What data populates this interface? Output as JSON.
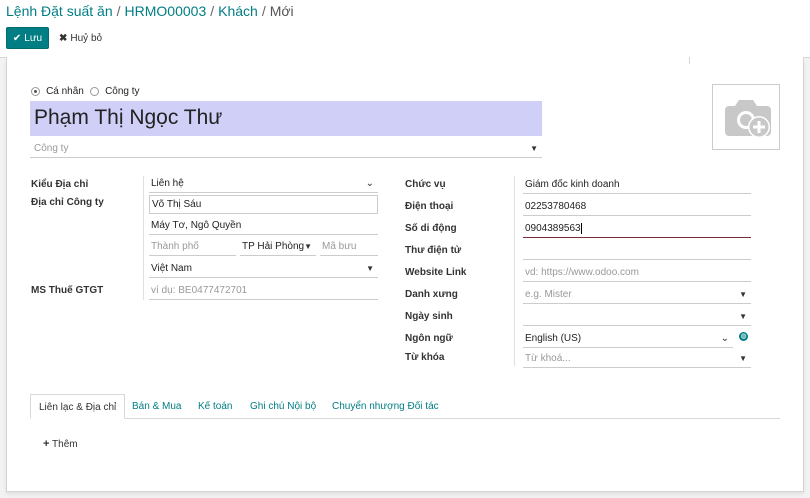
{
  "breadcrumb": {
    "item1": "Lệnh Đặt suất ăn",
    "item2": "HRMO00003",
    "item3": "Khách",
    "current": "Mới",
    "sep": "/"
  },
  "toolbar": {
    "save_label": "Lưu",
    "discard_label": "Huỷ bỏ"
  },
  "company_type": {
    "individual_label": "Cá nhân",
    "company_label": "Công ty",
    "selected": "individual"
  },
  "name_value": "Phạm Thị Ngọc Thư",
  "company_placeholder": "Công ty",
  "left": {
    "address_type_label": "Kiểu Địa chỉ",
    "address_type_value": "Liên hệ",
    "company_address_label": "Địa chỉ Công ty",
    "street": "Võ Thị Sáu",
    "street2": "Máy Tơ, Ngô Quyền",
    "city_placeholder": "Thành phố",
    "state": "TP Hải Phòng",
    "zip_placeholder": "Mã bưu điện",
    "country": "Việt Nam",
    "vat_label": "MS Thuế GTGT",
    "vat_placeholder": "ví dụ: BE0477472701"
  },
  "right": {
    "job_label": "Chức vụ",
    "job_value": "Giám đốc kinh doanh",
    "phone_label": "Điện thoại",
    "phone_value": "02253780468",
    "mobile_label": "Số di động",
    "mobile_value": "0904389563",
    "email_label": "Thư điện tử",
    "website_label": "Website Link",
    "website_placeholder": "vd: https://www.odoo.com",
    "title_label": "Danh xưng",
    "title_placeholder": "e.g. Mister",
    "birthday_label": "Ngày sinh",
    "lang_label": "Ngôn ngữ",
    "lang_value": "English (US)",
    "tags_label": "Từ khóa",
    "tags_placeholder": "Từ khoá..."
  },
  "tabs": [
    "Liên lạc & Địa chỉ",
    "Bán & Mua",
    "Kế toán",
    "Ghi chú Nội bộ",
    "Chuyển nhượng Đối tác"
  ],
  "add_label": "Thêm",
  "colors": {
    "accent": "#017e84",
    "name_bg": "#cfcff8",
    "active_field": "#7a2d3a"
  },
  "icons": [
    "check-icon",
    "close-icon",
    "caret-down-icon",
    "camera-plus-icon",
    "globe-icon",
    "plus-icon"
  ]
}
